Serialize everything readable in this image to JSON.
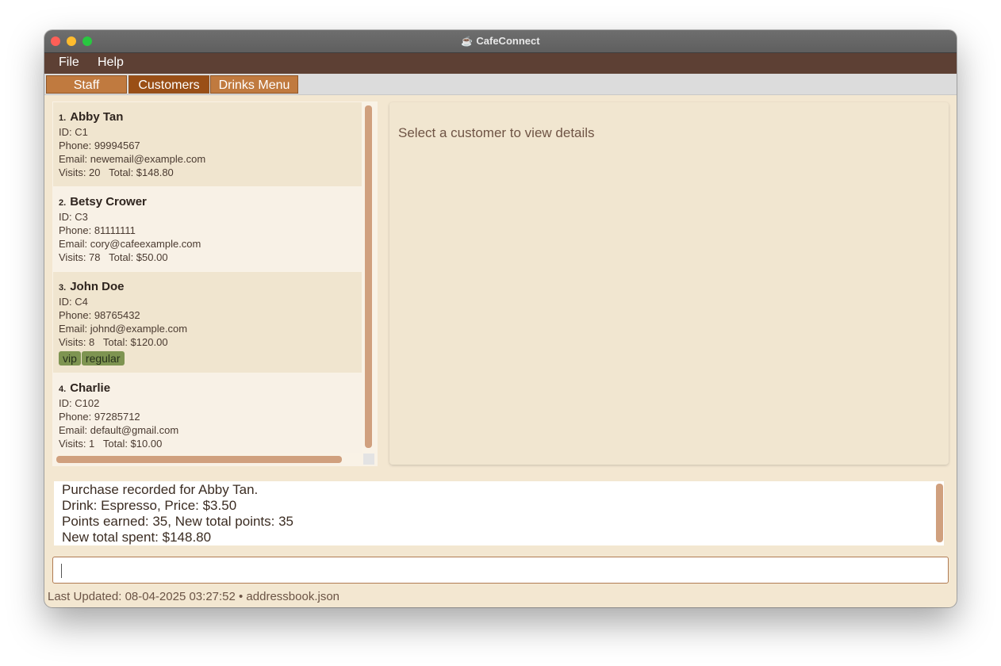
{
  "window": {
    "title": "CafeConnect",
    "title_icon": "cup-icon"
  },
  "menubar": {
    "items": [
      "File",
      "Help"
    ]
  },
  "tabs": [
    {
      "label": "Staff",
      "active": false
    },
    {
      "label": "Customers",
      "active": true
    },
    {
      "label": "Drinks Menu",
      "active": false
    }
  ],
  "customers": [
    {
      "index": "1.",
      "name": "Abby Tan",
      "id": "ID: C1",
      "phone": "Phone: 99994567",
      "email": "Email: newemail@example.com",
      "stats": "Visits: 20   Total: $148.80",
      "tags": []
    },
    {
      "index": "2.",
      "name": "Betsy Crower",
      "id": "ID: C3",
      "phone": "Phone: 81111111",
      "email": "Email: cory@cafeexample.com",
      "stats": "Visits: 78   Total: $50.00",
      "tags": []
    },
    {
      "index": "3.",
      "name": "John Doe",
      "id": "ID: C4",
      "phone": "Phone: 98765432",
      "email": "Email: johnd@example.com",
      "stats": "Visits: 8   Total: $120.00",
      "tags": [
        "vip",
        "regular"
      ]
    },
    {
      "index": "4.",
      "name": "Charlie",
      "id": "ID: C102",
      "phone": "Phone: 97285712",
      "email": "Email: default@gmail.com",
      "stats": "Visits: 1   Total: $10.00",
      "tags": []
    }
  ],
  "detail": {
    "placeholder": "Select a customer to view details"
  },
  "result": {
    "lines": [
      "Purchase recorded for Abby Tan.",
      "Drink: Espresso, Price: $3.50",
      "Points earned: 35, New total points: 35",
      "New total spent: $148.80"
    ]
  },
  "command": {
    "value": "",
    "placeholder": ""
  },
  "status": {
    "text": "Last Updated: 08-04-2025 03:27:52 • addressbook.json"
  },
  "colors": {
    "menubar": "#5d4034",
    "tab": "#c07a3f",
    "tab_active": "#9a4f16",
    "panel": "#f1e6d0",
    "tag": "#7e9451",
    "scrollbar": "#d0a07e"
  }
}
